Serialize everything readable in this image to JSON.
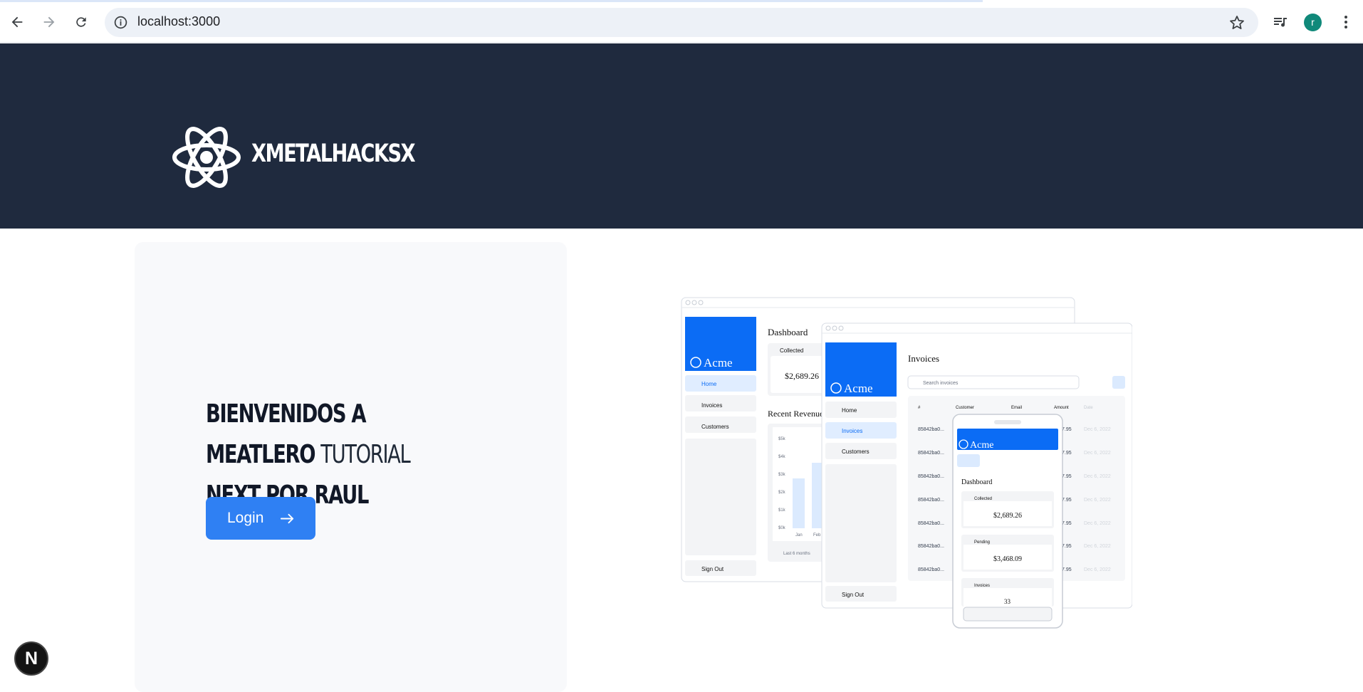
{
  "browser": {
    "url": "localhost:3000",
    "profile_initial": "r",
    "icons": [
      "back-icon",
      "forward-icon",
      "reload-icon",
      "site-info-icon",
      "bookmark-star-icon",
      "media-icon",
      "profile-avatar",
      "menu-icon"
    ]
  },
  "header": {
    "brand": "XMETALHACKSX",
    "logo_icon": "atom-logo"
  },
  "hero": {
    "welcome_bold": "BIENVENIDOS A MEATLERO ",
    "welcome_thin": "TUTORIAL",
    "welcome_line2": "NEXT POR RAUL",
    "login_label": "Login"
  },
  "mockup": {
    "desktop": {
      "brand": "Acme",
      "title": "Dashboard",
      "nav": [
        "Home",
        "Invoices",
        "Customers"
      ],
      "sign_out": "Sign Out",
      "collected_label": "Collected",
      "collected_value": "$2,689.26",
      "revenue_title": "Recent Revenue",
      "y_ticks": [
        "$5k",
        "$4k",
        "$3k",
        "$2k",
        "$1k",
        "$0k"
      ],
      "x_ticks": [
        "Jan",
        "Feb"
      ],
      "footer": "Last 6 months"
    },
    "tablet": {
      "brand": "Acme",
      "title": "Invoices",
      "search_placeholder": "Search invoices",
      "nav": [
        "Home",
        "Invoices",
        "Customers"
      ],
      "sign_out": "Sign Out",
      "columns": [
        "#",
        "Customer",
        "Email",
        "Amount",
        "Date"
      ],
      "row_ids": [
        "85842ba0...",
        "85842ba0...",
        "85842ba0...",
        "85842ba0...",
        "85842ba0...",
        "85842ba0...",
        "85842ba0..."
      ],
      "row_amount": "7.95",
      "row_date": "Dec 6, 2022"
    },
    "phone": {
      "brand": "Acme",
      "title": "Dashboard",
      "collected_label": "Collected",
      "collected_value": "$2,689.26",
      "pending_label": "Pending",
      "pending_value": "$3,468.09",
      "invoices_label": "Invoices",
      "invoices_value": "33"
    }
  },
  "fab_label": "N",
  "colors": {
    "hero_bg": "#1f2a3e",
    "accent": "#2f80f3",
    "card_bg": "#f8f9fb",
    "acme_blue": "#0b6cf5"
  }
}
